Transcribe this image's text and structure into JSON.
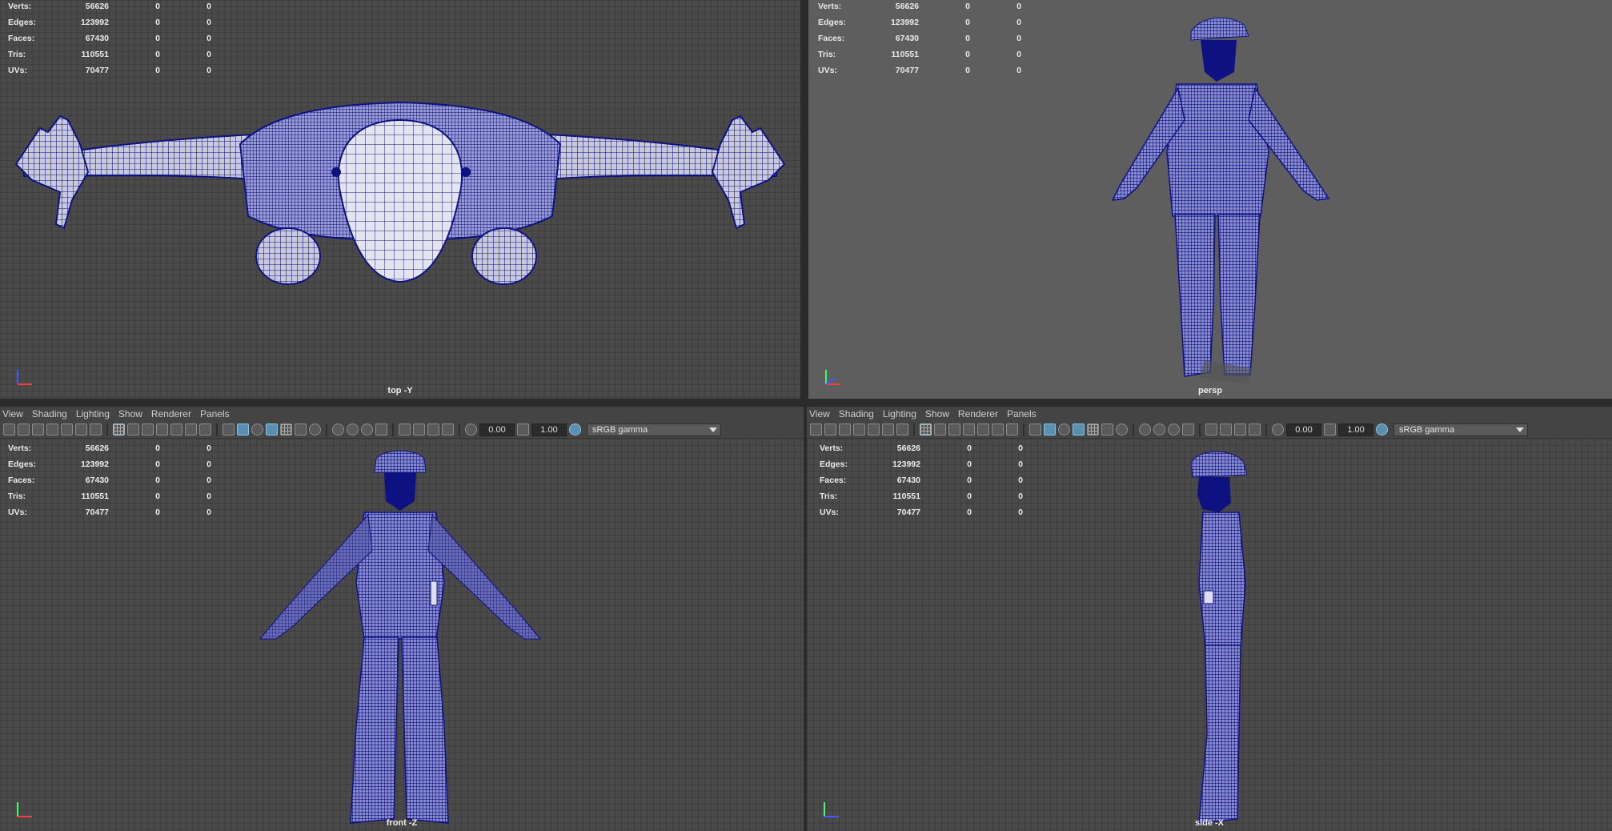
{
  "hud_stats": {
    "rows": [
      {
        "label": "Verts:",
        "total": "56626",
        "sel": "0",
        "comp": "0"
      },
      {
        "label": "Edges:",
        "total": "123992",
        "sel": "0",
        "comp": "0"
      },
      {
        "label": "Faces:",
        "total": "67430",
        "sel": "0",
        "comp": "0"
      },
      {
        "label": "Tris:",
        "total": "110551",
        "sel": "0",
        "comp": "0"
      },
      {
        "label": "UVs:",
        "total": "70477",
        "sel": "0",
        "comp": "0"
      }
    ]
  },
  "viewports": {
    "top": {
      "camera": "top -Y"
    },
    "persp": {
      "camera": "persp"
    },
    "front": {
      "camera": "front -Z"
    },
    "side": {
      "camera": "side -X"
    }
  },
  "panel_menu": [
    "View",
    "Shading",
    "Lighting",
    "Show",
    "Renderer",
    "Panels"
  ],
  "toolbar": {
    "exposure": "0.00",
    "gamma": "1.00",
    "color_space": "sRGB gamma"
  },
  "colors": {
    "wire": "#0d1280",
    "highlight": "#5a8fb0"
  }
}
